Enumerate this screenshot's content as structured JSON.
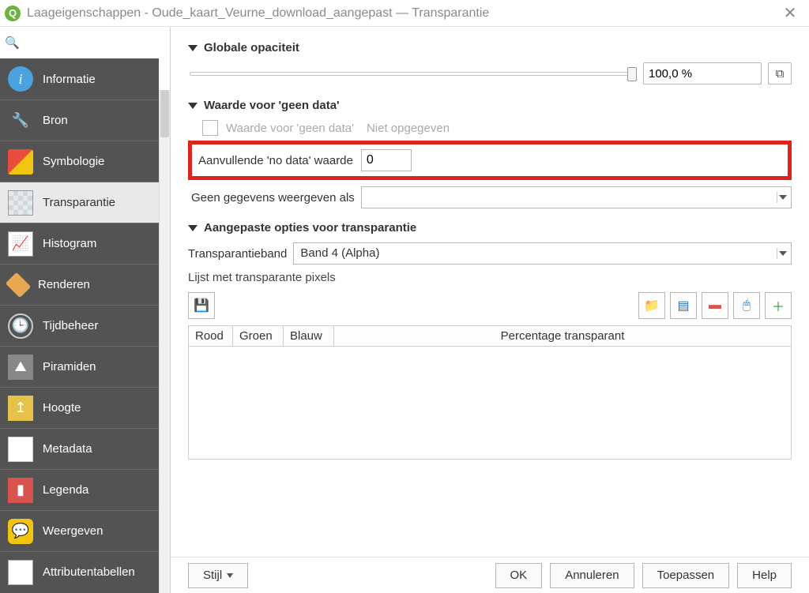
{
  "window": {
    "title": "Laageigenschappen - Oude_kaart_Veurne_download_aangepast — Transparantie"
  },
  "search": {
    "placeholder": ""
  },
  "sidebar": {
    "items": [
      {
        "label": "Informatie"
      },
      {
        "label": "Bron"
      },
      {
        "label": "Symbologie"
      },
      {
        "label": "Transparantie",
        "active": true
      },
      {
        "label": "Histogram"
      },
      {
        "label": "Renderen"
      },
      {
        "label": "Tijdbeheer"
      },
      {
        "label": "Piramiden"
      },
      {
        "label": "Hoogte"
      },
      {
        "label": "Metadata"
      },
      {
        "label": "Legenda"
      },
      {
        "label": "Weergeven"
      },
      {
        "label": "Attributentabellen"
      }
    ]
  },
  "sections": {
    "opacity": {
      "title": "Globale opaciteit",
      "value": "100,0 %"
    },
    "nodata": {
      "title": "Waarde voor 'geen data'",
      "row_label": "Waarde voor 'geen data'",
      "not_given": "Niet opgegeven",
      "additional_label": "Aanvullende 'no data' waarde",
      "additional_value": "0",
      "display_as_label": "Geen gegevens weergeven als",
      "display_as_value": ""
    },
    "custom": {
      "title": "Aangepaste opties voor transparantie",
      "band_label": "Transparantieband",
      "band_value": "Band 4 (Alpha)",
      "list_label": "Lijst met transparante pixels",
      "columns": {
        "r": "Rood",
        "g": "Groen",
        "b": "Blauw",
        "pct": "Percentage transparant"
      }
    }
  },
  "buttons": {
    "style": "Stijl",
    "ok": "OK",
    "cancel": "Annuleren",
    "apply": "Toepassen",
    "help": "Help"
  },
  "icons": {
    "save": "💾",
    "folder": "📁",
    "grid": "▤",
    "minus": "▬",
    "pick": "🖱",
    "plus": "＋"
  }
}
